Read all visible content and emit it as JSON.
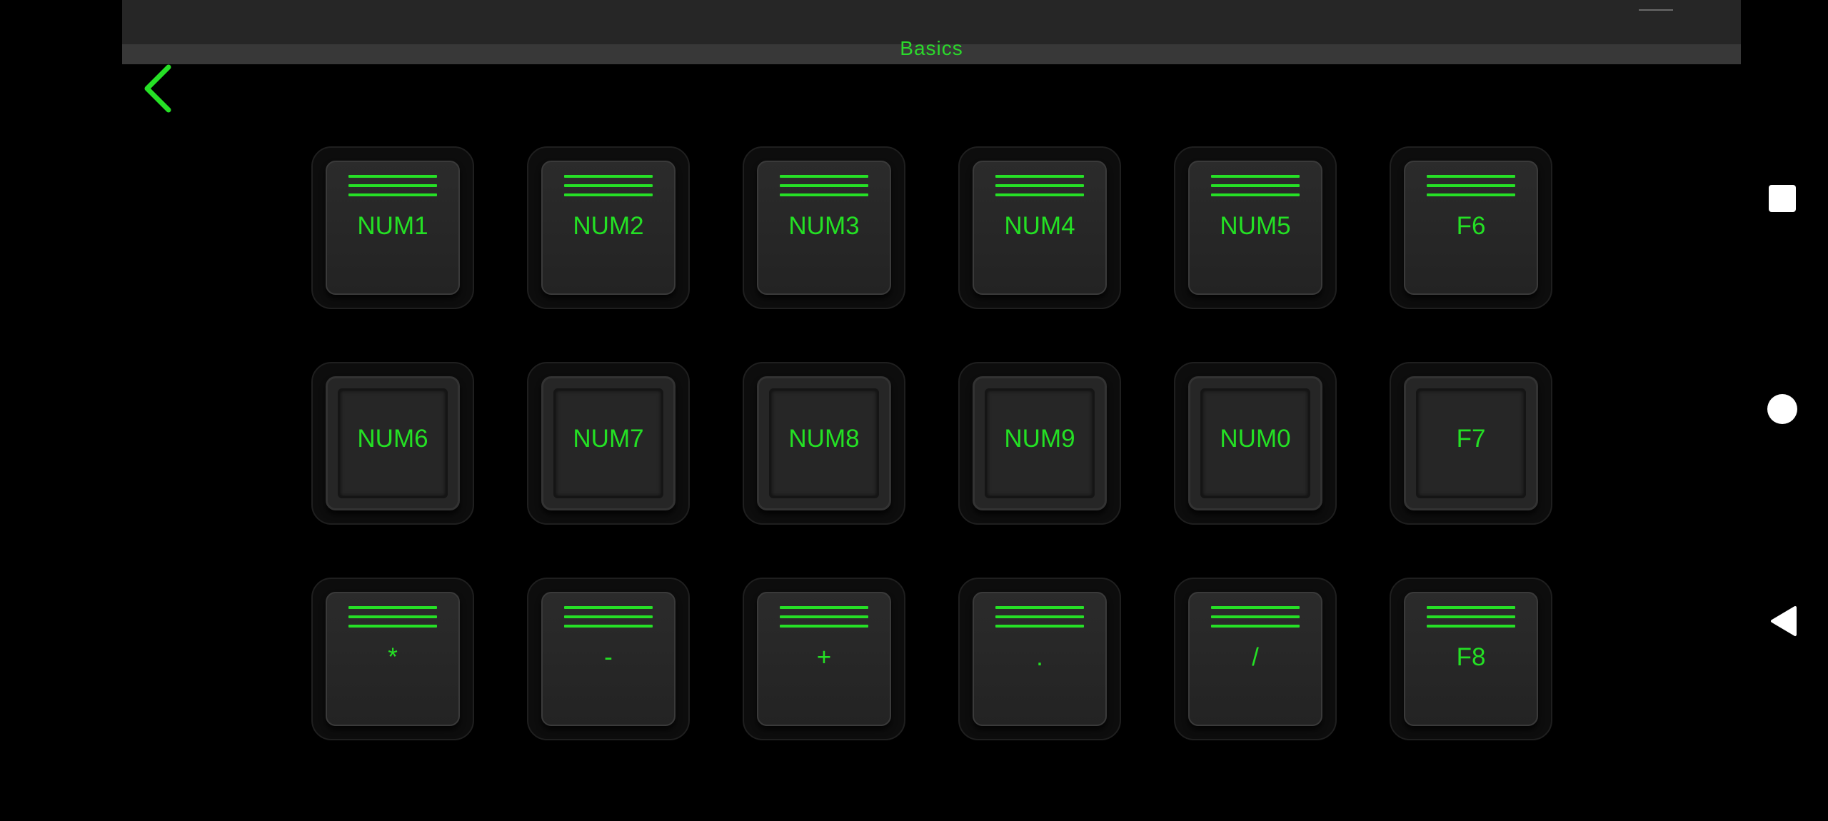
{
  "header": {
    "title": "Basics"
  },
  "back_icon": "chevron-left-icon",
  "accent_color": "#26e026",
  "keys": [
    {
      "label": "NUM1",
      "state": "raised"
    },
    {
      "label": "NUM2",
      "state": "raised"
    },
    {
      "label": "NUM3",
      "state": "raised"
    },
    {
      "label": "NUM4",
      "state": "raised"
    },
    {
      "label": "NUM5",
      "state": "raised"
    },
    {
      "label": "F6",
      "state": "raised"
    },
    {
      "label": "NUM6",
      "state": "pressed"
    },
    {
      "label": "NUM7",
      "state": "pressed"
    },
    {
      "label": "NUM8",
      "state": "pressed"
    },
    {
      "label": "NUM9",
      "state": "pressed"
    },
    {
      "label": "NUM0",
      "state": "pressed"
    },
    {
      "label": "F7",
      "state": "pressed"
    },
    {
      "label": "*",
      "state": "raised"
    },
    {
      "label": "-",
      "state": "raised"
    },
    {
      "label": "+",
      "state": "raised"
    },
    {
      "label": ".",
      "state": "raised"
    },
    {
      "label": "/",
      "state": "raised"
    },
    {
      "label": "F8",
      "state": "raised"
    }
  ],
  "system_nav": {
    "recents_icon": "square-icon",
    "home_icon": "circle-icon",
    "back_icon": "triangle-back-icon"
  }
}
